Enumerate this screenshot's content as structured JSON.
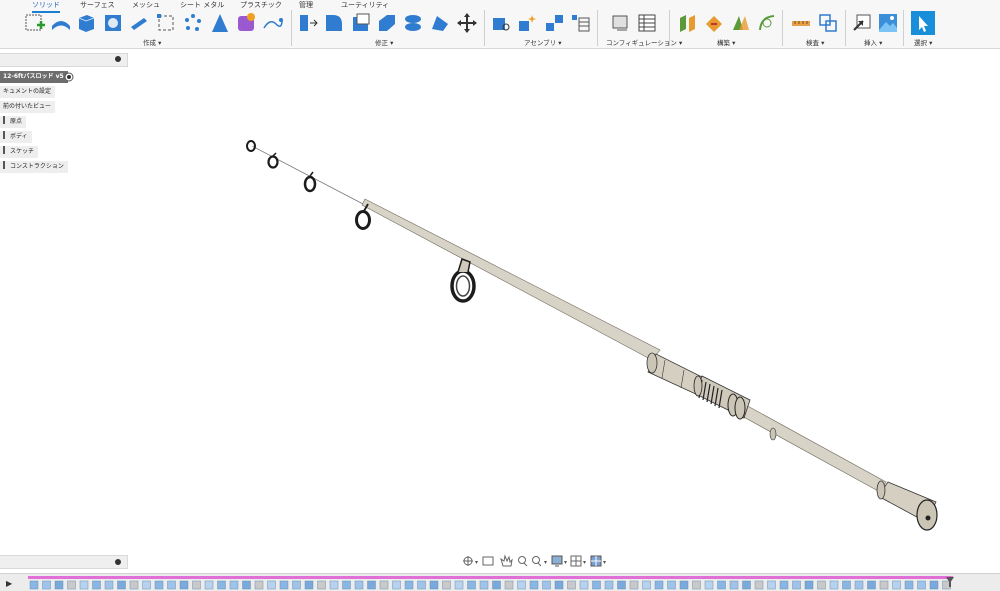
{
  "tabs": [
    {
      "label": "ソリッド",
      "active": true
    },
    {
      "label": "サーフェス",
      "active": false
    },
    {
      "label": "メッシュ",
      "active": false
    },
    {
      "label": "シート メタル",
      "active": false
    },
    {
      "label": "プラスチック",
      "active": false
    },
    {
      "label": "管理",
      "active": false
    },
    {
      "label": "ユーティリティ",
      "active": false
    }
  ],
  "groups": [
    "作成 ▾",
    "修正 ▾",
    "アセンブリ ▾",
    "コンフィギュレーション ▾",
    "構築 ▾",
    "検査 ▾",
    "挿入 ▾",
    "選択 ▾"
  ],
  "browser": {
    "root": "12-6ftバスロッド v5",
    "items": [
      "キュメントの設定",
      "前の付いたビュー",
      "原点",
      "ボディ",
      "スケッチ",
      "コンストラクション"
    ]
  },
  "colors": {
    "accent": "#1a7fd1",
    "rod": "#d8d3c7",
    "guide": "#1c1c1c",
    "timeline": "#e070d8"
  }
}
